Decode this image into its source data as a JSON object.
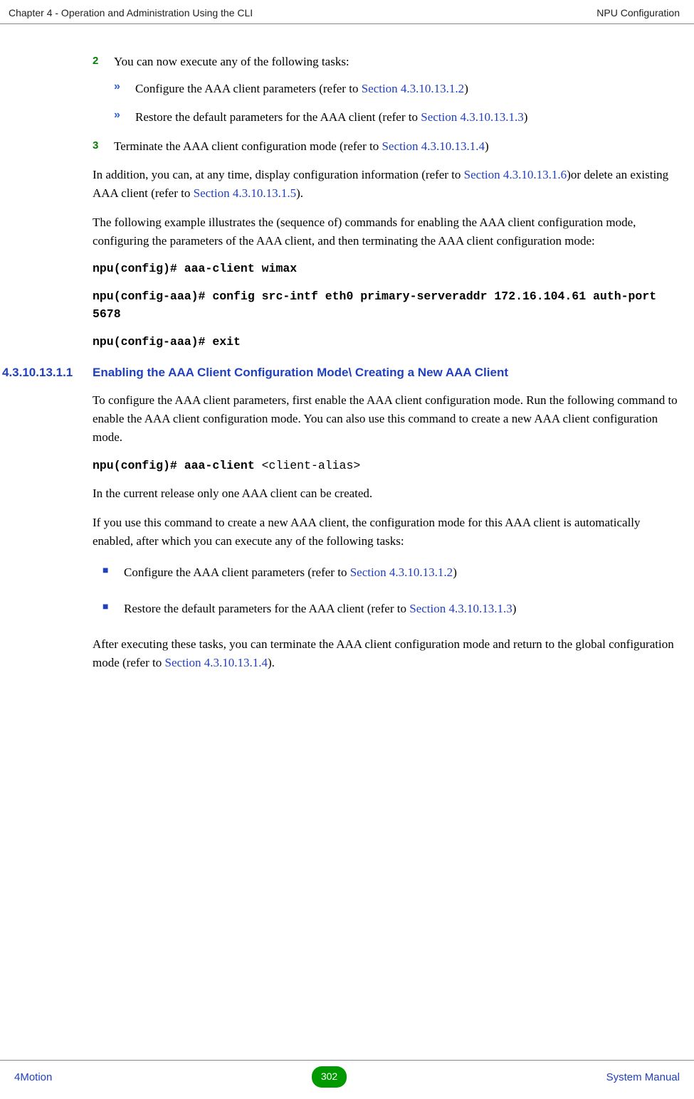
{
  "header": {
    "left": "Chapter 4 - Operation and Administration Using the CLI",
    "right": "NPU Configuration"
  },
  "step2": {
    "num": "2",
    "text": "You can now execute any of the following tasks:"
  },
  "sub_a": {
    "glyph": "»",
    "pre": "Configure the AAA client parameters (refer to ",
    "link": "Section 4.3.10.13.1.2",
    "post": ")"
  },
  "sub_b": {
    "glyph": "»",
    "pre": "Restore the default parameters for the AAA client (refer to ",
    "link": "Section 4.3.10.13.1.3",
    "post": ")"
  },
  "step3": {
    "num": "3",
    "pre": "Terminate the AAA client configuration mode (refer to ",
    "link": "Section 4.3.10.13.1.4",
    "post": ")"
  },
  "para1": {
    "pre": "In addition, you can, at any time, display configuration information (refer to ",
    "link1": "Section 4.3.10.13.1.6",
    "mid": ")or delete an existing AAA client (refer to ",
    "link2": "Section 4.3.10.13.1.5",
    "post": ")."
  },
  "para2": "The following example illustrates the (sequence of) commands for enabling the AAA client configuration mode, configuring the parameters of the AAA client, and then terminating the AAA client configuration mode:",
  "code1": "npu(config)# aaa-client wimax",
  "code2": "npu(config-aaa)# config src-intf eth0 primary-serveraddr 172.16.104.61 auth-port 5678",
  "code3": "npu(config-aaa)# exit",
  "heading": {
    "num": "4.3.10.13.1.1",
    "text": "Enabling the AAA Client Configuration Mode\\ Creating a New AAA Client"
  },
  "para3": "To configure the AAA client parameters, first enable the AAA client configuration mode. Run the following command to enable the AAA client configuration mode. You can also use this command to create a new AAA client configuration mode.",
  "code4a": "npu(config)# aaa-client ",
  "code4b": "<client-alias>",
  "para4": "In the current release only one AAA client can be created.",
  "para5": "If you use this command to create a new AAA client, the configuration mode for this AAA client is automatically enabled, after which you can execute any of the following tasks:",
  "sq_a": {
    "pre": "Configure the AAA client parameters (refer to ",
    "link": "Section 4.3.10.13.1.2",
    "post": ")"
  },
  "sq_b": {
    "pre": "Restore the default parameters for the AAA client (refer to ",
    "link": "Section 4.3.10.13.1.3",
    "post": ")"
  },
  "para6": {
    "pre": "After executing these tasks, you can terminate the AAA client configuration mode and return to the global configuration mode (refer to ",
    "link": "Section 4.3.10.13.1.4",
    "post": ")."
  },
  "footer": {
    "left": "4Motion",
    "page": "302",
    "right": " System Manual"
  }
}
